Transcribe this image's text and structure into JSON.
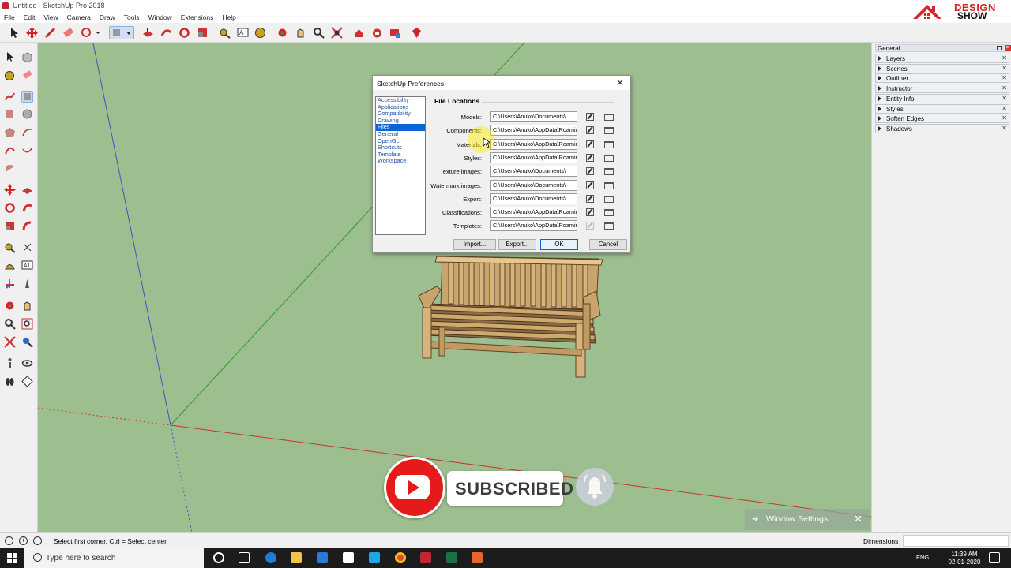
{
  "app": {
    "title": "Untitled - SketchUp Pro 2018"
  },
  "menu": [
    "File",
    "Edit",
    "View",
    "Camera",
    "Draw",
    "Tools",
    "Window",
    "Extensions",
    "Help"
  ],
  "logo": {
    "line1": "DESIGN",
    "line2": "SHOW"
  },
  "tray": {
    "header": "General",
    "items": [
      "Layers",
      "Scenes",
      "Outliner",
      "Instructor",
      "Entity Info",
      "Styles",
      "Soften Edges",
      "Shadows"
    ]
  },
  "dialog": {
    "title": "SketchUp Preferences",
    "categories": [
      "Accessibility",
      "Applications",
      "Compatibility",
      "Drawing",
      "Files",
      "General",
      "OpenGL",
      "Shortcuts",
      "Template",
      "Workspace"
    ],
    "selected_category": "Files",
    "section_title": "File Locations",
    "rows": [
      {
        "label": "Models:",
        "path": "C:\\Users\\Anuko\\Documents\\"
      },
      {
        "label": "Components:",
        "path": "C:\\Users\\Anuko\\AppData\\Roamir"
      },
      {
        "label": "Materials:",
        "path": "C:\\Users\\Anuko\\AppData\\Roamir"
      },
      {
        "label": "Styles:",
        "path": "C:\\Users\\Anuko\\AppData\\Roamir"
      },
      {
        "label": "Texture images:",
        "path": "C:\\Users\\Anuko\\Documents\\"
      },
      {
        "label": "Watermark images:",
        "path": "C:\\Users\\Anuko\\Documents\\"
      },
      {
        "label": "Export:",
        "path": "C:\\Users\\Anuko\\Documents\\"
      },
      {
        "label": "Classifications:",
        "path": "C:\\Users\\Anuko\\AppData\\Roamir"
      },
      {
        "label": "Templates:",
        "path": "C:\\Users\\Anuko\\AppData\\Roamir"
      }
    ],
    "buttons": {
      "import": "Import...",
      "export": "Export...",
      "ok": "OK",
      "cancel": "Cancel"
    }
  },
  "overlay": {
    "subscribed": "SUBSCRIBED",
    "window_settings": "Window Settings"
  },
  "status": {
    "message": "Select first corner. Ctrl = Select center.",
    "dimensions_label": "Dimensions"
  },
  "taskbar": {
    "search_placeholder": "Type here to search",
    "lang": "ENG",
    "time": "11:39 AM",
    "date": "02-01-2020"
  },
  "colors": {
    "viewport": "#9dbf8f",
    "accent": "#0a64d8",
    "youtube": "#e51b1b",
    "taskbar": "#1c1c1c"
  }
}
